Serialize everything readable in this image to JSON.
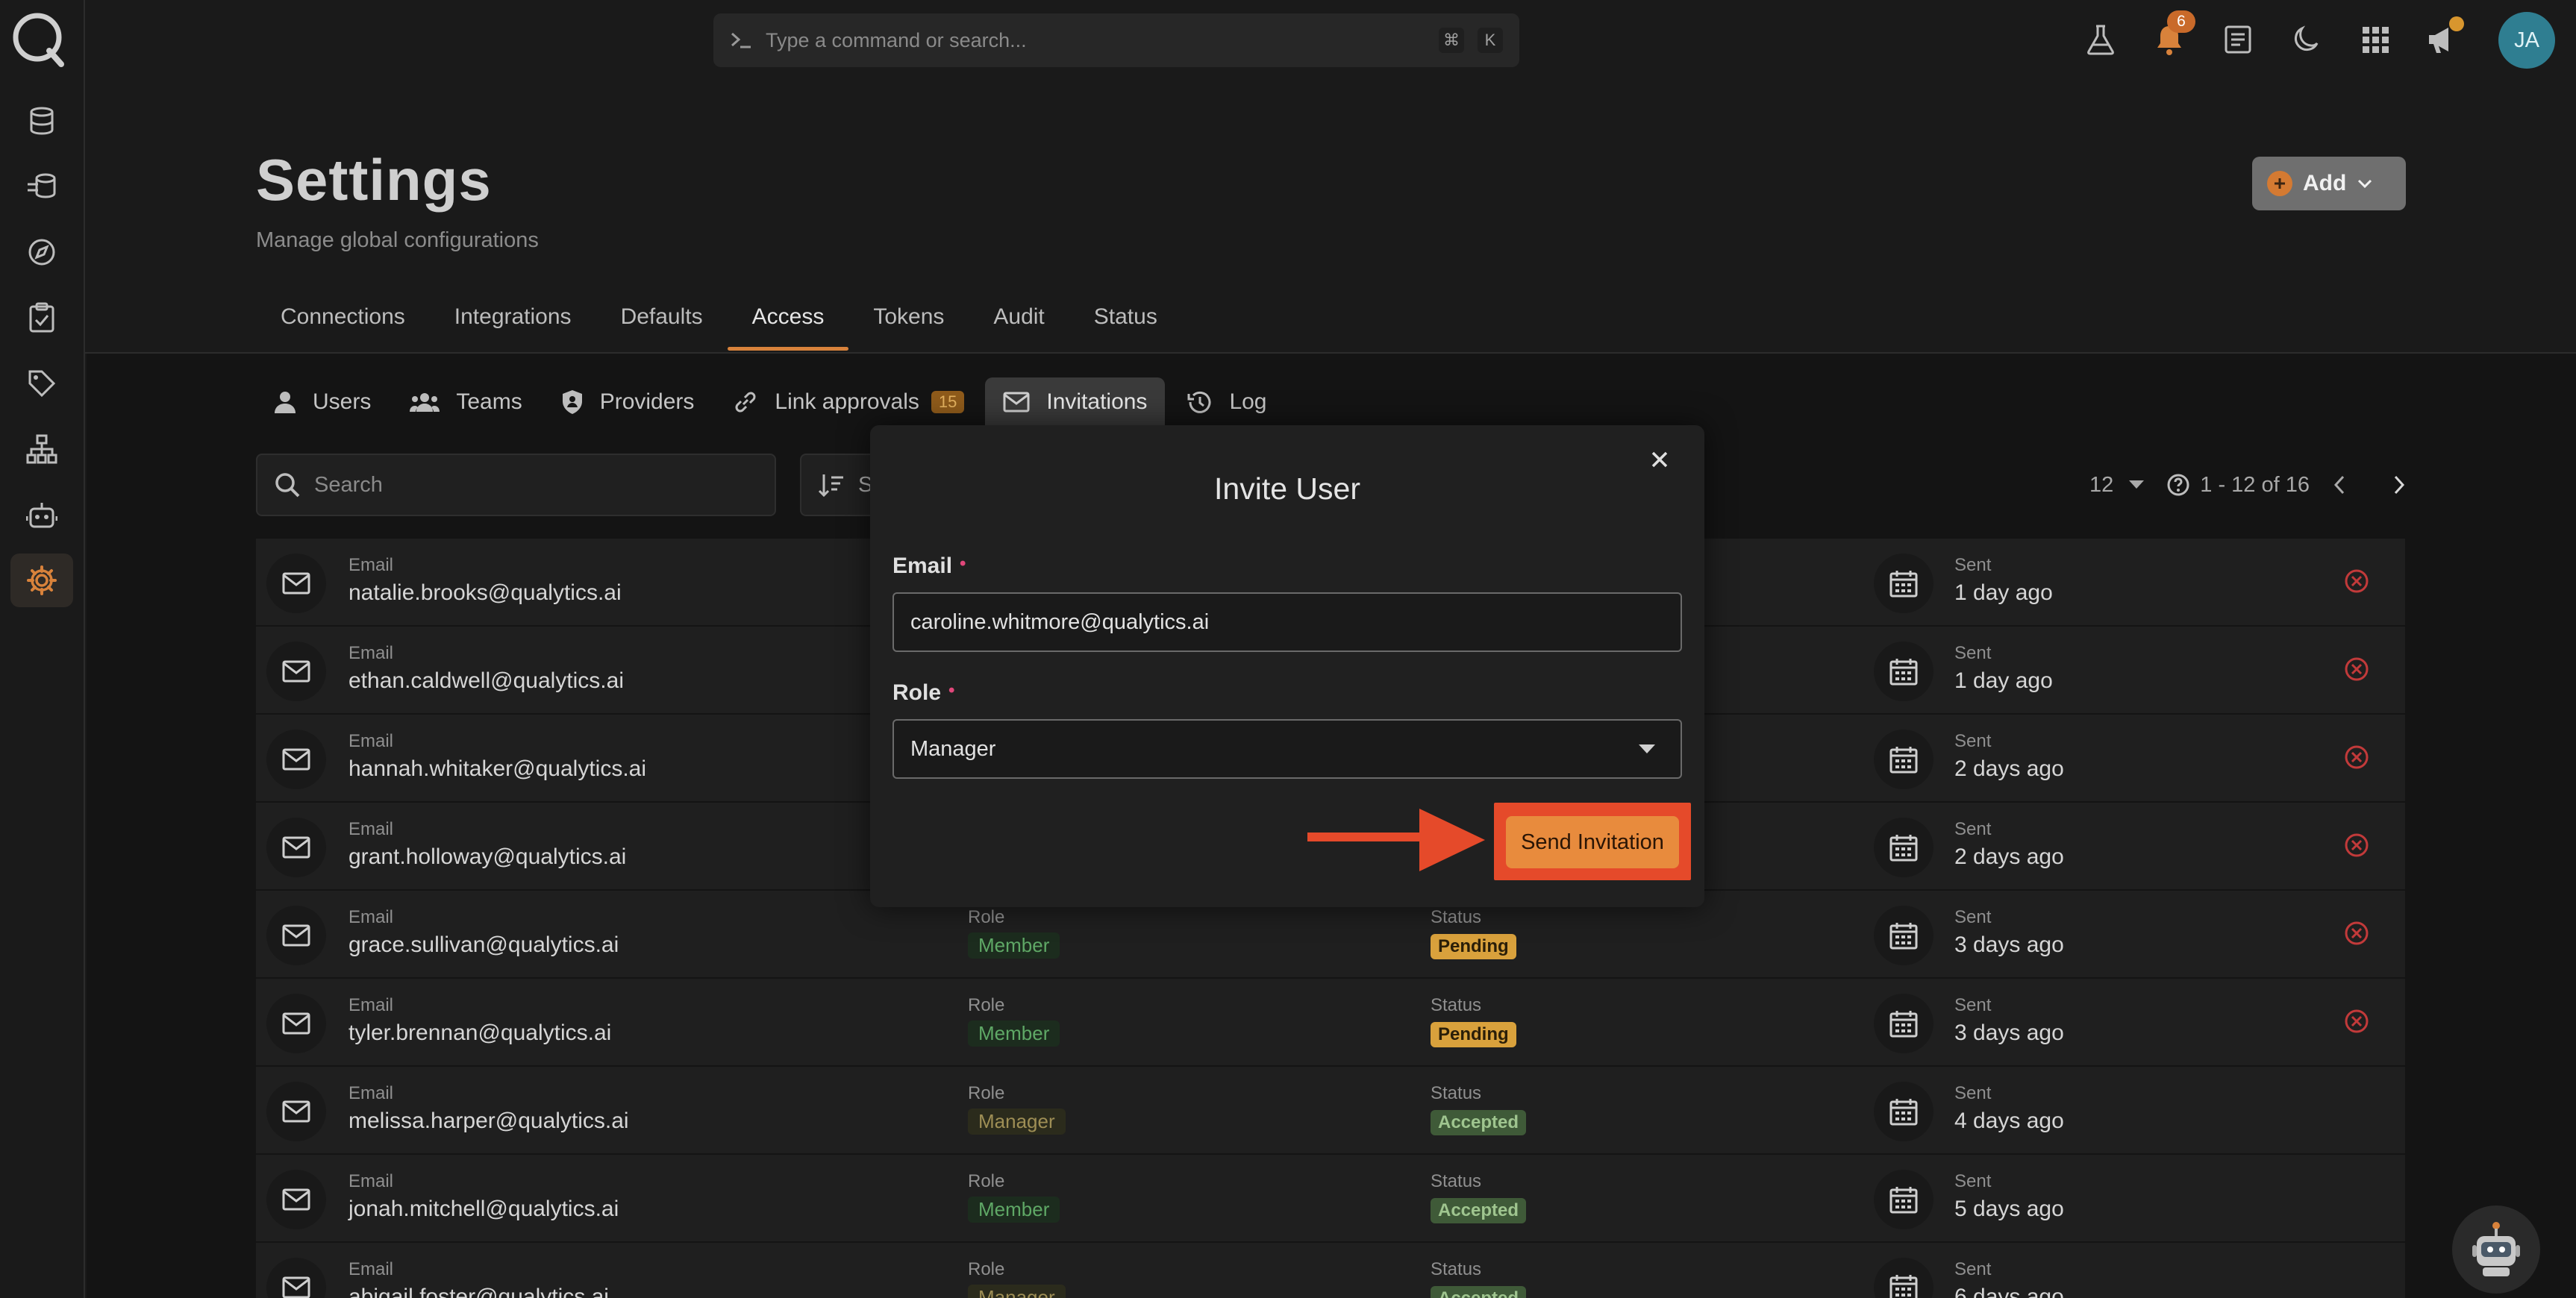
{
  "command_bar": {
    "placeholder": "Type a command or search...",
    "shortcut_cmd": "⌘",
    "shortcut_key": "K"
  },
  "notifications": {
    "count": "6"
  },
  "user": {
    "initials": "JA"
  },
  "header": {
    "title": "Settings",
    "subtitle": "Manage global configurations",
    "add_label": "Add"
  },
  "main_tabs": [
    "Connections",
    "Integrations",
    "Defaults",
    "Access",
    "Tokens",
    "Audit",
    "Status"
  ],
  "sub_tabs": {
    "users": "Users",
    "teams": "Teams",
    "providers": "Providers",
    "link_approvals": "Link approvals",
    "link_approvals_count": "15",
    "invitations": "Invitations",
    "log": "Log"
  },
  "toolbar": {
    "search_placeholder": "Search",
    "sort_label": "S",
    "page_size": "12",
    "range": "1 - 12 of 16"
  },
  "labels": {
    "email": "Email",
    "role": "Role",
    "status": "Status",
    "sent": "Sent"
  },
  "rows": [
    {
      "email": "natalie.brooks@qualytics.ai",
      "role": "",
      "status": "",
      "sent": "1 day ago"
    },
    {
      "email": "ethan.caldwell@qualytics.ai",
      "role": "",
      "status": "",
      "sent": "1 day ago"
    },
    {
      "email": "hannah.whitaker@qualytics.ai",
      "role": "",
      "status": "",
      "sent": "2 days ago"
    },
    {
      "email": "grant.holloway@qualytics.ai",
      "role": "",
      "status": "",
      "sent": "2 days ago"
    },
    {
      "email": "grace.sullivan@qualytics.ai",
      "role": "Member",
      "status": "Pending",
      "sent": "3 days ago"
    },
    {
      "email": "tyler.brennan@qualytics.ai",
      "role": "Member",
      "status": "Pending",
      "sent": "3 days ago"
    },
    {
      "email": "melissa.harper@qualytics.ai",
      "role": "Manager",
      "status": "Accepted",
      "sent": "4 days ago"
    },
    {
      "email": "jonah.mitchell@qualytics.ai",
      "role": "Member",
      "status": "Accepted",
      "sent": "5 days ago"
    },
    {
      "email": "abigail.foster@qualytics.ai",
      "role": "Manager",
      "status": "Accepted",
      "sent": "6 days ago"
    }
  ],
  "modal": {
    "title": "Invite User",
    "email_label": "Email",
    "email_value": "caroline.whitmore@qualytics.ai",
    "role_label": "Role",
    "role_value": "Manager",
    "send_label": "Send Invitation",
    "required_mark": "•"
  },
  "colors": {
    "accent": "#d8823b",
    "highlight": "#e54a2a",
    "button": "#e88b3d"
  }
}
